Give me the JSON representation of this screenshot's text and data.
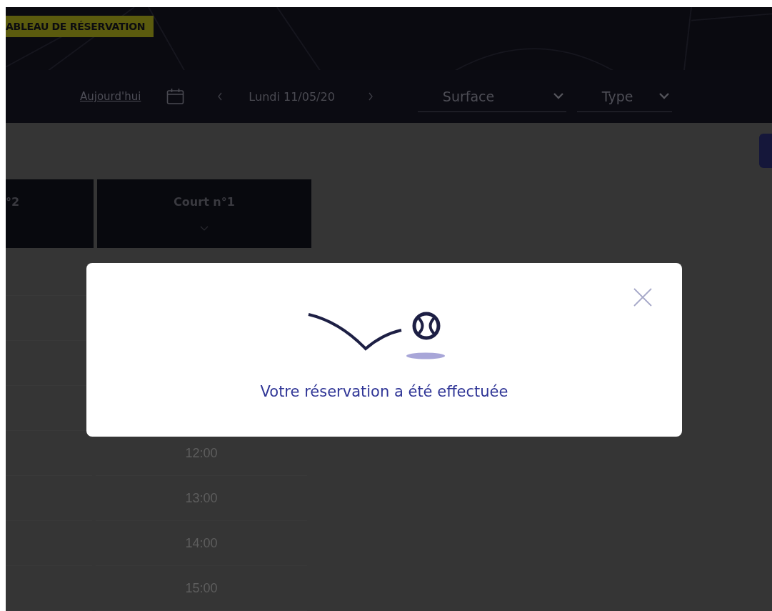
{
  "header": {
    "title": "ABLEAU DE RÉSERVATION"
  },
  "toolbar": {
    "today_link": "Aujourd'hui",
    "date": "Lundi 11/05/20",
    "filters": [
      {
        "label": "Surface"
      },
      {
        "label": "Type"
      }
    ]
  },
  "columns": [
    {
      "label": "°2"
    },
    {
      "label": "Court n°1"
    }
  ],
  "time_slots": [
    "12:00",
    "13:00",
    "14:00",
    "15:00"
  ],
  "modal": {
    "message": "Votre réservation a été effectuée"
  }
}
